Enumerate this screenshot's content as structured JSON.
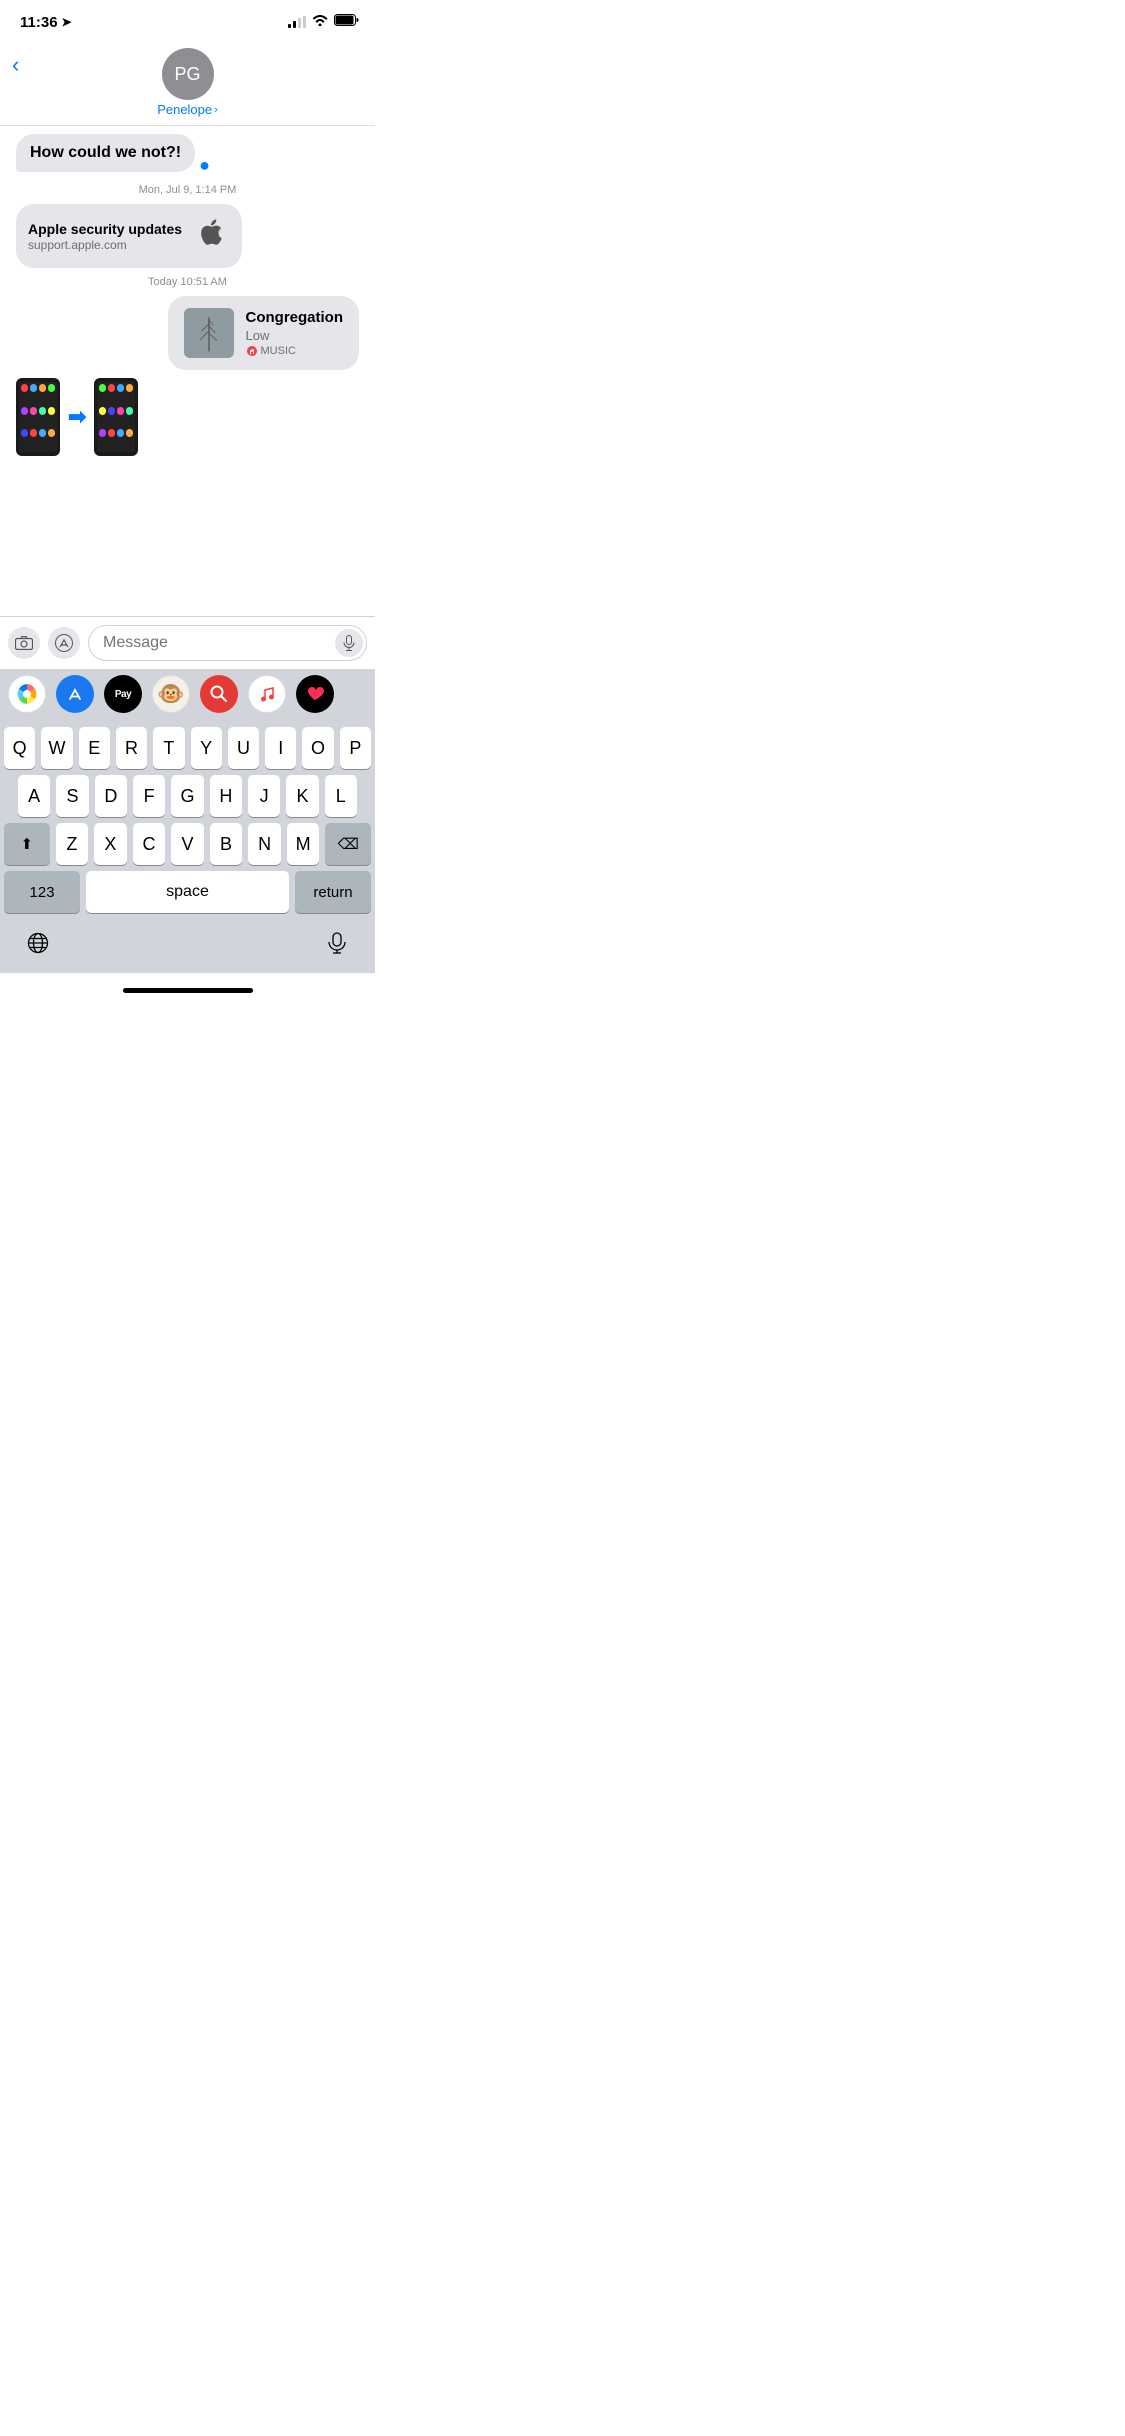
{
  "statusBar": {
    "time": "11:36",
    "locationIcon": "➤"
  },
  "header": {
    "backLabel": "‹",
    "avatarInitials": "PG",
    "contactName": "Penelope",
    "contactArrow": "›"
  },
  "messages": {
    "prevBubble": "How could we not?!",
    "timestamp1": "Mon, Jul 9, 1:14 PM",
    "linkPreview": {
      "title": "Apple security updates",
      "url": "support.apple.com",
      "logo": ""
    },
    "timestamp2": "Today 10:51 AM",
    "musicMessage": {
      "songTitle": "Congregation",
      "artist": "Low",
      "service": "MUSIC"
    }
  },
  "messageInput": {
    "placeholder": "Message"
  },
  "iApps": [
    {
      "name": "Photos",
      "emoji": "🌅",
      "bg": "#fff"
    },
    {
      "name": "App Store",
      "emoji": "🅰",
      "bg": "#1a78f0"
    },
    {
      "name": "Apple Pay",
      "text": "Pay",
      "bg": "#000"
    },
    {
      "name": "Monkey Emoji",
      "emoji": "🐵",
      "bg": "#fff"
    },
    {
      "name": "Search",
      "emoji": "🔍",
      "bg": "#e53935"
    },
    {
      "name": "Music",
      "emoji": "🎵",
      "bg": "#fff"
    },
    {
      "name": "Favorites",
      "emoji": "❤️",
      "bg": "#000"
    }
  ],
  "keyboard": {
    "row1": [
      "Q",
      "W",
      "E",
      "R",
      "T",
      "Y",
      "U",
      "I",
      "O",
      "P"
    ],
    "row2": [
      "A",
      "S",
      "D",
      "F",
      "G",
      "H",
      "J",
      "K",
      "L"
    ],
    "row3": [
      "Z",
      "X",
      "C",
      "V",
      "B",
      "N",
      "M"
    ],
    "specialKeys": {
      "numbers": "123",
      "space": "space",
      "return": "return",
      "shift": "⬆",
      "delete": "⌫"
    }
  }
}
